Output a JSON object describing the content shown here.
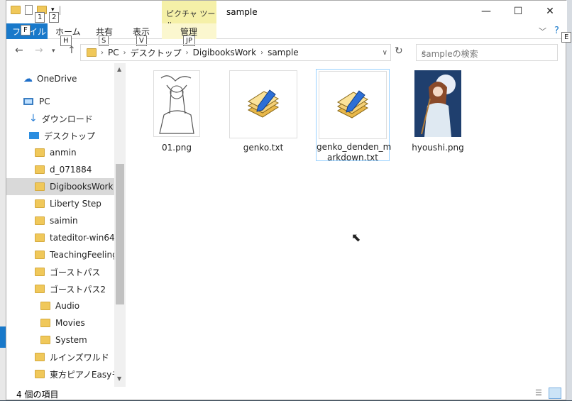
{
  "window": {
    "title": "sample",
    "context_tab": "ピクチャ ツール"
  },
  "quick_access": {
    "key1": "1",
    "key2": "2"
  },
  "ribbon": {
    "file": "ファイル",
    "file_key": "F",
    "home": "ホーム",
    "home_key": "H",
    "share": "共有",
    "share_key": "S",
    "view": "表示",
    "view_key": "V",
    "manage": "管理",
    "manage_key": "JP",
    "expand_key": "E"
  },
  "address": {
    "crumbs": [
      "PC",
      "デスクトップ",
      "DigibooksWork",
      "sample"
    ]
  },
  "search": {
    "placeholder": "sampleの検索"
  },
  "nav": [
    {
      "label": "OneDrive",
      "type": "onedrive"
    },
    {
      "label": "PC",
      "type": "pc"
    },
    {
      "label": "ダウンロード",
      "type": "download"
    },
    {
      "label": "デスクトップ",
      "type": "desktop"
    },
    {
      "label": "anmin",
      "type": "folder"
    },
    {
      "label": "d_071884",
      "type": "folder"
    },
    {
      "label": "DigibooksWork",
      "type": "folder",
      "selected": true
    },
    {
      "label": "Liberty Step",
      "type": "folder"
    },
    {
      "label": "saimin",
      "type": "folder"
    },
    {
      "label": "tateditor-win64",
      "type": "folder"
    },
    {
      "label": "TeachingFeeling-v",
      "type": "folder"
    },
    {
      "label": "ゴーストパス",
      "type": "folder"
    },
    {
      "label": "ゴーストパス2",
      "type": "folder"
    },
    {
      "label": "Audio",
      "type": "subfolder"
    },
    {
      "label": "Movies",
      "type": "subfolder"
    },
    {
      "label": "System",
      "type": "subfolder"
    },
    {
      "label": "ルインズワルド",
      "type": "folder"
    },
    {
      "label": "東方ピアノEasyモー",
      "type": "folder"
    }
  ],
  "files": [
    {
      "name": "01.png",
      "kind": "sketch"
    },
    {
      "name": "genko.txt",
      "kind": "text"
    },
    {
      "name": "genko_denden_markdown.txt",
      "line1": "genko_denden_m",
      "line2": "arkdown.txt",
      "kind": "text",
      "selected": true
    },
    {
      "name": "hyoushi.png",
      "kind": "cover"
    }
  ],
  "status": {
    "count": "4 個の項目"
  }
}
